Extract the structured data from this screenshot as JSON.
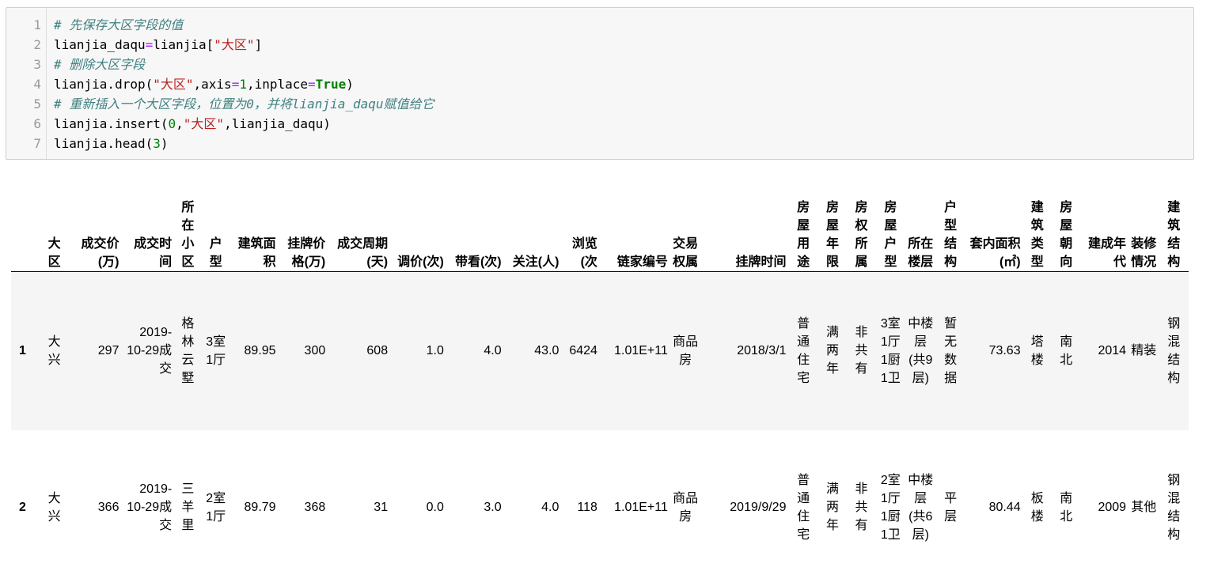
{
  "code": {
    "line_numbers": [
      "1",
      "2",
      "3",
      "4",
      "5",
      "6",
      "7"
    ],
    "l1_comment": "# 先保存大区字段的值",
    "l2_a": "lianjia_daqu",
    "l2_eq": "=",
    "l2_b": "lianjia[",
    "l2_str": "\"大区\"",
    "l2_c": "]",
    "l3_comment": "# 删除大区字段",
    "l4_a": "lianjia.drop(",
    "l4_str": "\"大区\"",
    "l4_b": ",axis",
    "l4_eq": "=",
    "l4_num": "1",
    "l4_c": ",inplace",
    "l4_eq2": "=",
    "l4_kw": "True",
    "l4_d": ")",
    "l5_comment": "# 重新插入一个大区字段，位置为0，并将lianjia_daqu赋值给它",
    "l6_a": "lianjia.insert(",
    "l6_num": "0",
    "l6_b": ",",
    "l6_str": "\"大区\"",
    "l6_c": ",lianjia_daqu)",
    "l7_a": "lianjia.head(",
    "l7_num": "3",
    "l7_b": ")"
  },
  "table": {
    "columns": [
      "大区",
      "成交价(万)",
      "成交时间",
      "所在小区",
      "户型",
      "建筑面积",
      "挂牌价格(万)",
      "成交周期(天)",
      "调价(次)",
      "带看(次)",
      "关注(人)",
      "浏览(次",
      "链家编号",
      "交易权属",
      "挂牌时间",
      "房屋用途",
      "房屋年限",
      "房权所属",
      "房屋户型",
      "所在楼层",
      "户型结构",
      "套内面积(㎡)",
      "建筑类型",
      "房屋朝向",
      "建成年代",
      "装修情况",
      "建筑结构"
    ],
    "rows": [
      {
        "index": "1",
        "cells": [
          "大兴",
          "297",
          "2019-10-29成交",
          "格林云墅",
          "3室1厅",
          "89.95",
          "300",
          "608",
          "1.0",
          "4.0",
          "43.0",
          "6424",
          "1.01E+11",
          "商品房",
          "2018/3/1",
          "普通住宅",
          "满两年",
          "非共有",
          "3室1厅1厨1卫",
          "中楼层(共9层)",
          "暂无数据",
          "73.63",
          "塔楼",
          "南北",
          "2014",
          "精装",
          "钢混结构"
        ]
      },
      {
        "index": "2",
        "cells": [
          "大兴",
          "366",
          "2019-10-29成交",
          "三羊里",
          "2室1厅",
          "89.79",
          "368",
          "31",
          "0.0",
          "3.0",
          "4.0",
          "118",
          "1.01E+11",
          "商品房",
          "2019/9/29",
          "普通住宅",
          "满两年",
          "非共有",
          "2室1厅1厨1卫",
          "中楼层(共6层)",
          "平层",
          "80.44",
          "板楼",
          "南北",
          "2009",
          "其他",
          "钢混结构"
        ]
      }
    ]
  }
}
